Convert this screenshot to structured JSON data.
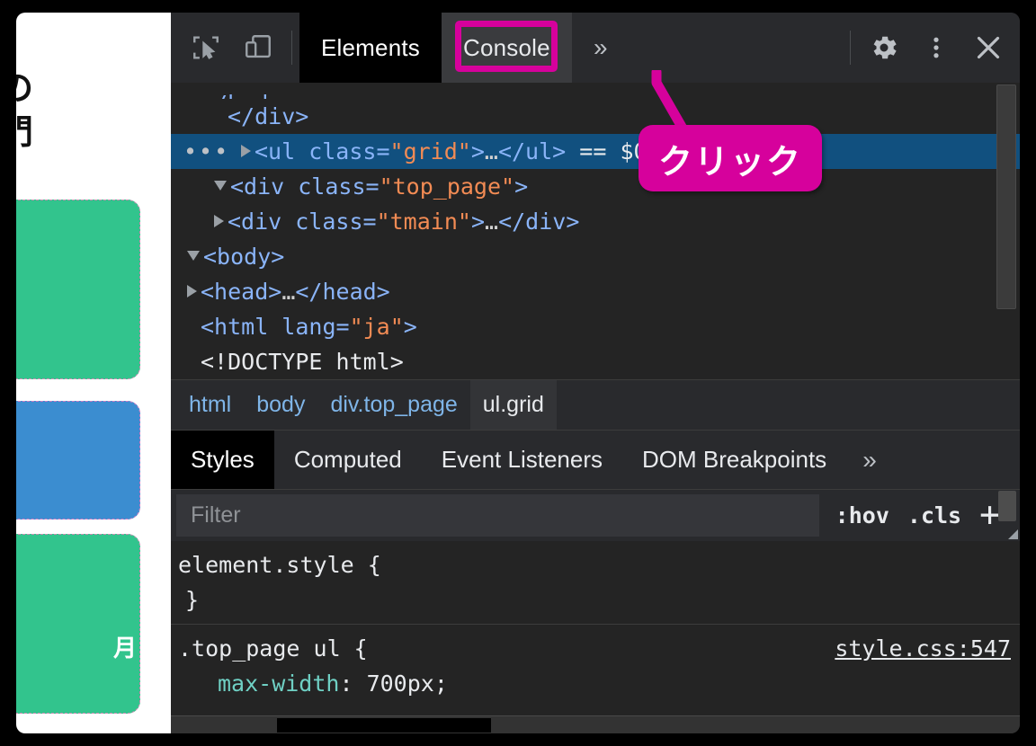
{
  "page": {
    "heading_lines": [
      "めの",
      "入門"
    ],
    "cards": [
      {
        "name": "card-green-top",
        "color": "#32c48d",
        "label": ""
      },
      {
        "name": "card-blue",
        "color": "#3b8dd0",
        "label": ""
      },
      {
        "name": "card-green-bottom",
        "color": "#32c48d",
        "label": "月"
      }
    ]
  },
  "devtools": {
    "toolbar": {
      "inspect_icon": "inspect-element-icon",
      "device_icon": "device-toolbar-icon",
      "tabs": [
        {
          "label": "Elements",
          "active": true
        },
        {
          "label": "Console",
          "active": false,
          "highlighted": true
        }
      ],
      "more_tabs": "»",
      "settings_icon": "gear-icon",
      "menu_icon": "three-dot-menu-icon",
      "close_icon": "close-icon"
    },
    "callout": {
      "text": "クリック",
      "color": "#d6019c"
    },
    "dom_tree": {
      "lines": [
        {
          "indent": 0,
          "arrow": "none",
          "parts": [
            {
              "t": "<!DOCTYPE html>",
              "c": "doc"
            }
          ]
        },
        {
          "indent": 0,
          "arrow": "none",
          "parts": [
            {
              "t": "<html lang=",
              "c": "tag"
            },
            {
              "t": "\"ja\"",
              "c": "val"
            },
            {
              "t": ">",
              "c": "tag"
            }
          ]
        },
        {
          "indent": 0,
          "arrow": "closed",
          "parts": [
            {
              "t": "<head>",
              "c": "tag"
            },
            {
              "t": "…",
              "c": "txt"
            },
            {
              "t": "</head>",
              "c": "tag"
            }
          ]
        },
        {
          "indent": 0,
          "arrow": "open",
          "parts": [
            {
              "t": "<body>",
              "c": "tag"
            }
          ]
        },
        {
          "indent": 1,
          "arrow": "closed",
          "parts": [
            {
              "t": "<div class=",
              "c": "tag"
            },
            {
              "t": "\"tmain\"",
              "c": "val"
            },
            {
              "t": ">",
              "c": "tag"
            },
            {
              "t": "…",
              "c": "txt"
            },
            {
              "t": "</div>",
              "c": "tag"
            }
          ]
        },
        {
          "indent": 1,
          "arrow": "open",
          "parts": [
            {
              "t": "<div class=",
              "c": "tag"
            },
            {
              "t": "\"top_page\"",
              "c": "val"
            },
            {
              "t": ">",
              "c": "tag"
            }
          ]
        },
        {
          "indent": 2,
          "arrow": "closed",
          "selected": true,
          "dots": "•••",
          "parts": [
            {
              "t": "<ul class=",
              "c": "tag"
            },
            {
              "t": "\"grid\"",
              "c": "val"
            },
            {
              "t": ">",
              "c": "tag"
            },
            {
              "t": "…",
              "c": "txt"
            },
            {
              "t": "</ul>",
              "c": "tag"
            },
            {
              "t": " == ",
              "c": "dollar"
            },
            {
              "t": "$0",
              "c": "dollar"
            }
          ]
        },
        {
          "indent": 1,
          "arrow": "none",
          "parts": [
            {
              "t": "</div>",
              "c": "tag"
            }
          ]
        },
        {
          "indent": 0,
          "arrow": "none",
          "clipped": true,
          "parts": [
            {
              "t": "</body>",
              "c": "tag"
            }
          ]
        }
      ]
    },
    "breadcrumb": [
      {
        "label": "html",
        "active": false
      },
      {
        "label": "body",
        "active": false
      },
      {
        "label": "div.top_page",
        "active": false
      },
      {
        "label": "ul.grid",
        "active": true
      }
    ],
    "sidebar_tabs": [
      {
        "label": "Styles",
        "active": true
      },
      {
        "label": "Computed",
        "active": false
      },
      {
        "label": "Event Listeners",
        "active": false
      },
      {
        "label": "DOM Breakpoints",
        "active": false
      },
      {
        "label": "»",
        "active": false,
        "more": true
      }
    ],
    "filter": {
      "placeholder": "Filter",
      "value": "",
      "hov_label": ":hov",
      "cls_label": ".cls",
      "add_label": "+"
    },
    "style_rules": [
      {
        "selector": "element.style {",
        "source": "",
        "declarations": [],
        "closing": "}"
      },
      {
        "selector": ".top_page ul {",
        "source": "style.css:547",
        "declarations": [
          {
            "prop": "max-width",
            "value": "700px;"
          }
        ],
        "closing": ""
      }
    ]
  }
}
